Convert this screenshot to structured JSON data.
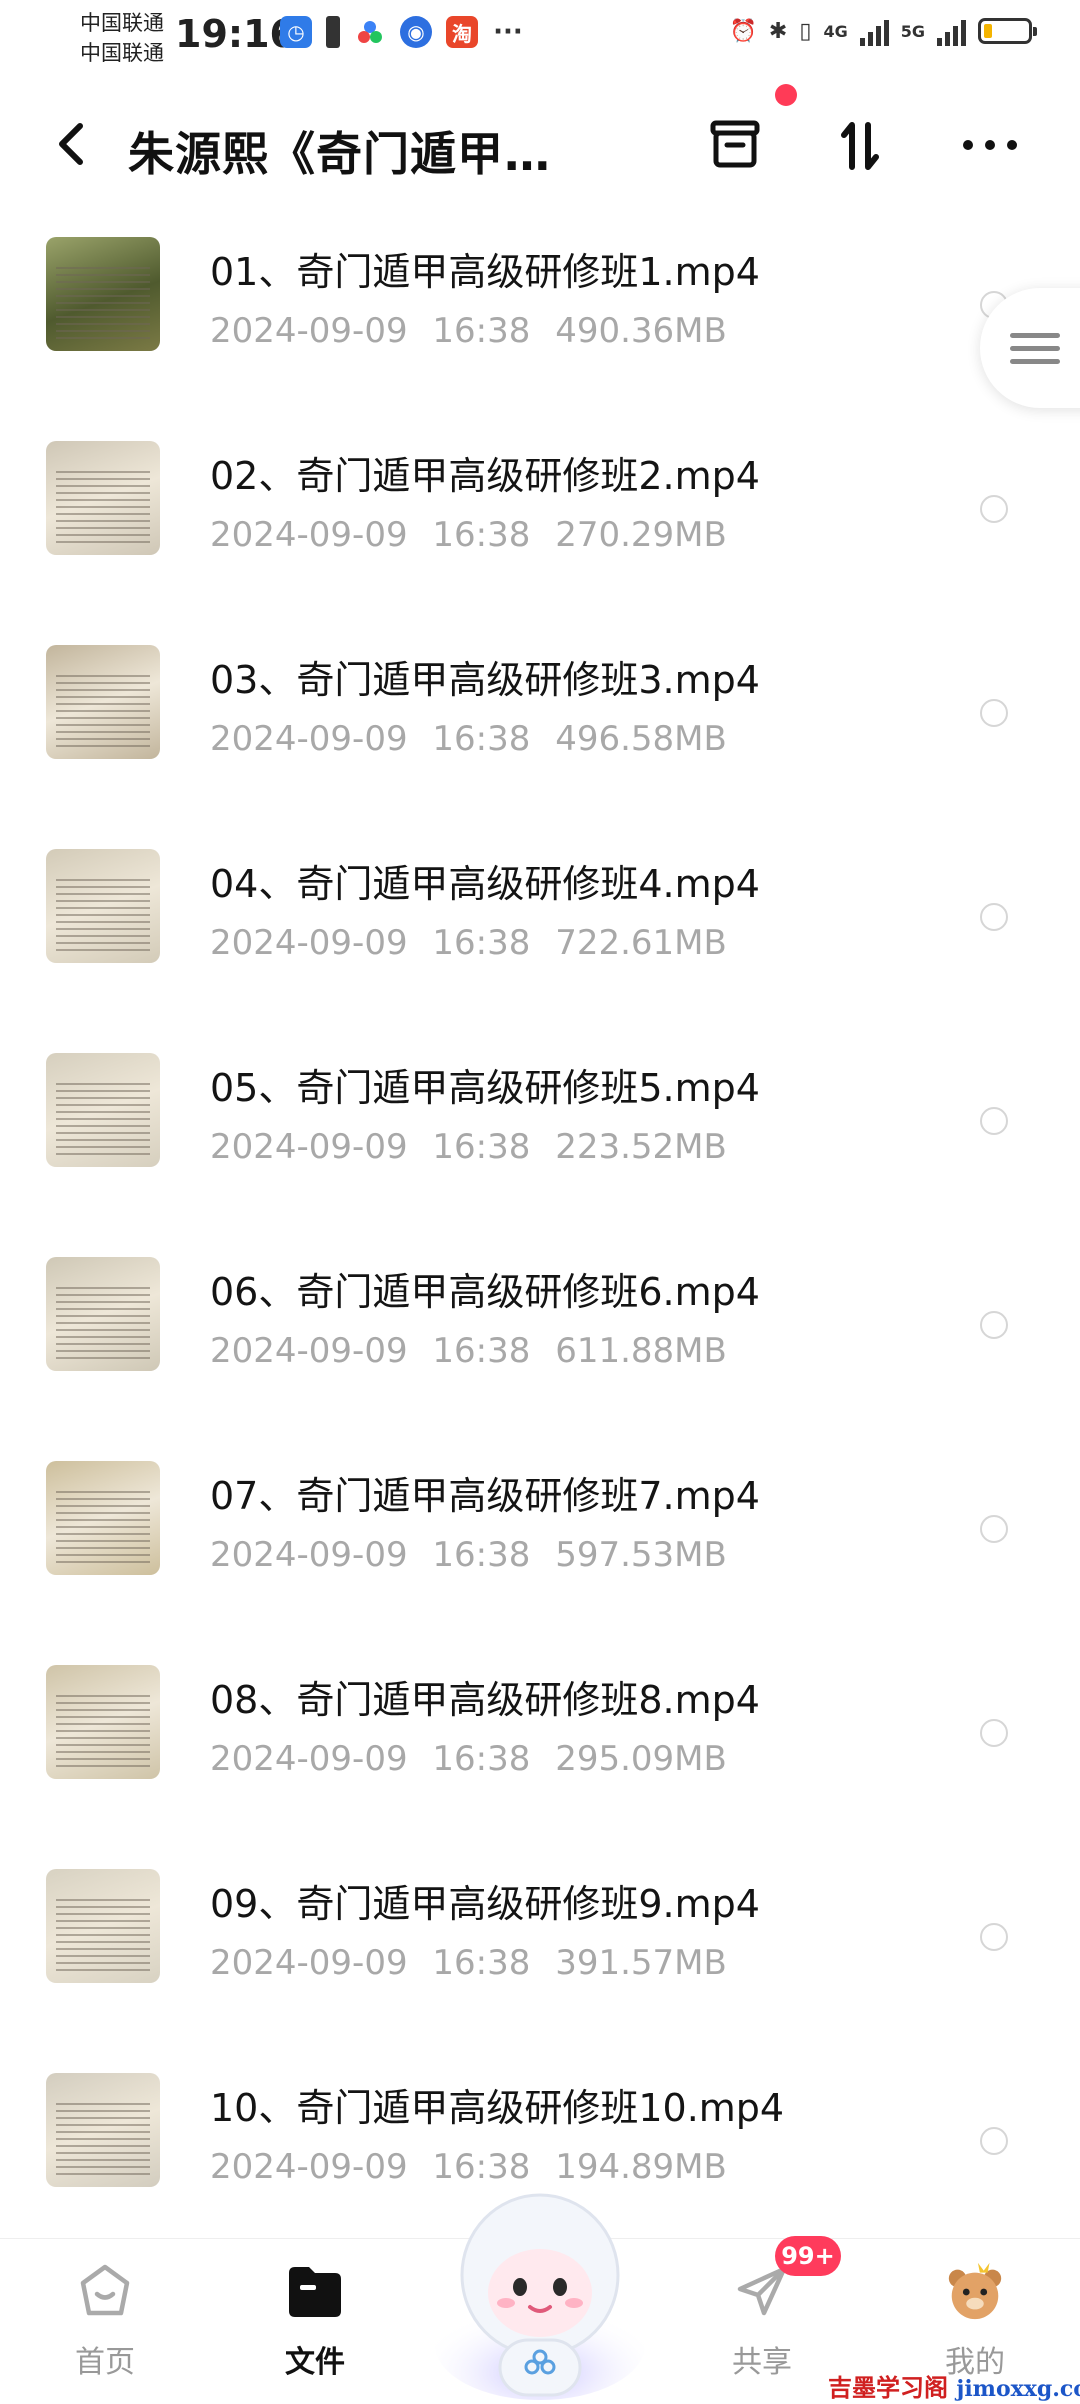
{
  "status_bar": {
    "carrier_1": "中国联通",
    "carrier_2": "中国联通",
    "time": "19:16",
    "network_1": "4G",
    "network_2": "5G",
    "battery_level": 0.18,
    "more_glyph": "···"
  },
  "header": {
    "title": "朱源熙《奇门遁甲…",
    "back_icon": "chevron-left-icon",
    "recycle_icon": "recycle-bin-icon",
    "sort_icon": "sort-icon",
    "more_icon": "more-horizontal-icon"
  },
  "files": [
    {
      "name": "01、奇门遁甲高级研修班1.mp4",
      "date": "2024-09-09",
      "time": "16:38",
      "size": "490.36MB"
    },
    {
      "name": "02、奇门遁甲高级研修班2.mp4",
      "date": "2024-09-09",
      "time": "16:38",
      "size": "270.29MB"
    },
    {
      "name": "03、奇门遁甲高级研修班3.mp4",
      "date": "2024-09-09",
      "time": "16:38",
      "size": "496.58MB"
    },
    {
      "name": "04、奇门遁甲高级研修班4.mp4",
      "date": "2024-09-09",
      "time": "16:38",
      "size": "722.61MB"
    },
    {
      "name": "05、奇门遁甲高级研修班5.mp4",
      "date": "2024-09-09",
      "time": "16:38",
      "size": "223.52MB"
    },
    {
      "name": "06、奇门遁甲高级研修班6.mp4",
      "date": "2024-09-09",
      "time": "16:38",
      "size": "611.88MB"
    },
    {
      "name": "07、奇门遁甲高级研修班7.mp4",
      "date": "2024-09-09",
      "time": "16:38",
      "size": "597.53MB"
    },
    {
      "name": "08、奇门遁甲高级研修班8.mp4",
      "date": "2024-09-09",
      "time": "16:38",
      "size": "295.09MB"
    },
    {
      "name": "09、奇门遁甲高级研修班9.mp4",
      "date": "2024-09-09",
      "time": "16:38",
      "size": "391.57MB"
    },
    {
      "name": "10、奇门遁甲高级研修班10.mp4",
      "date": "2024-09-09",
      "time": "16:38",
      "size": "194.89MB"
    }
  ],
  "nav": {
    "home_label": "首页",
    "files_label": "文件",
    "share_label": "共享",
    "mine_label": "我的",
    "share_badge": "99+"
  },
  "watermark": {
    "cn": "吉墨学习阁",
    "url": "jimoxxg.com"
  },
  "colors": {
    "accent_red": "#ff3b57",
    "meta_gray": "#a8a8a8",
    "text_dark": "#141414"
  }
}
